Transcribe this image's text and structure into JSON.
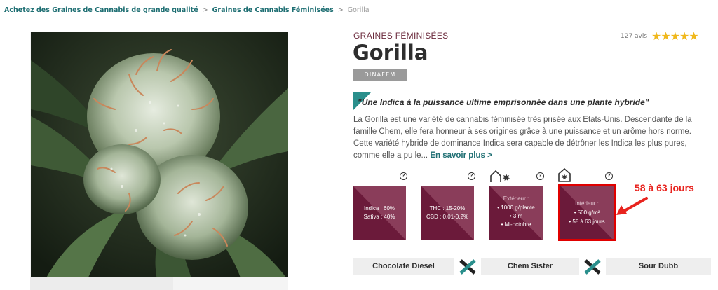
{
  "breadcrumb": {
    "items": [
      "Achetez des Graines de Cannabis de grande qualité",
      "Graines de Cannabis Féminisées",
      "Gorilla"
    ],
    "separator": ">"
  },
  "product": {
    "category": "GRAINES FÉMINISÉES",
    "title": "Gorilla",
    "brand": "DINAFEM",
    "reviews_text": "127 avis",
    "rating": 5,
    "stars_text": "★★★★★",
    "tagline": "\"Une Indica à la puissance ultime emprisonnée dans une plante hybride\"",
    "description": "La Gorilla est une variété de cannabis féminisée très prisée aux Etats-Unis. Descendante de la famille Chem, elle fera honneur à ses origines grâce à une puissance et un arôme hors norme. Cette variété hybride de dominance Indica sera capable de détrôner les Indica les plus pures, comme elle a pu le...",
    "learn_more": "En savoir plus >"
  },
  "cards": {
    "genetics": {
      "line1": "Indica : 60%",
      "line2": "Sativa : 40%"
    },
    "cannabinoids": {
      "line1": "THC : 15-20%",
      "line2": "CBD : 0,01-0,2%"
    },
    "outdoor": {
      "title": "Extérieur :",
      "line1": "• 1000 g/plante",
      "line2": "• 3 m",
      "line3": "• Mi-octobre"
    },
    "indoor": {
      "title": "Intérieur :",
      "line1": "• 500 g/m²",
      "line2": "• 58 à 63 jours"
    },
    "help_mark": "?"
  },
  "annotation": {
    "callout": "58 à 63 jours",
    "color": "#e8231e"
  },
  "varieties": [
    "Chocolate Diesel",
    "Chem Sister",
    "Sour Dubb"
  ],
  "colors": {
    "accent_teal": "#1f6f73",
    "card_dark": "#6b1a3a",
    "card_light": "#8a3d5a",
    "star": "#f0b81c"
  },
  "icons": [
    "help-icon",
    "outdoor-house-icon",
    "indoor-house-icon",
    "star-icon",
    "arrow-icon",
    "cross-icon"
  ]
}
